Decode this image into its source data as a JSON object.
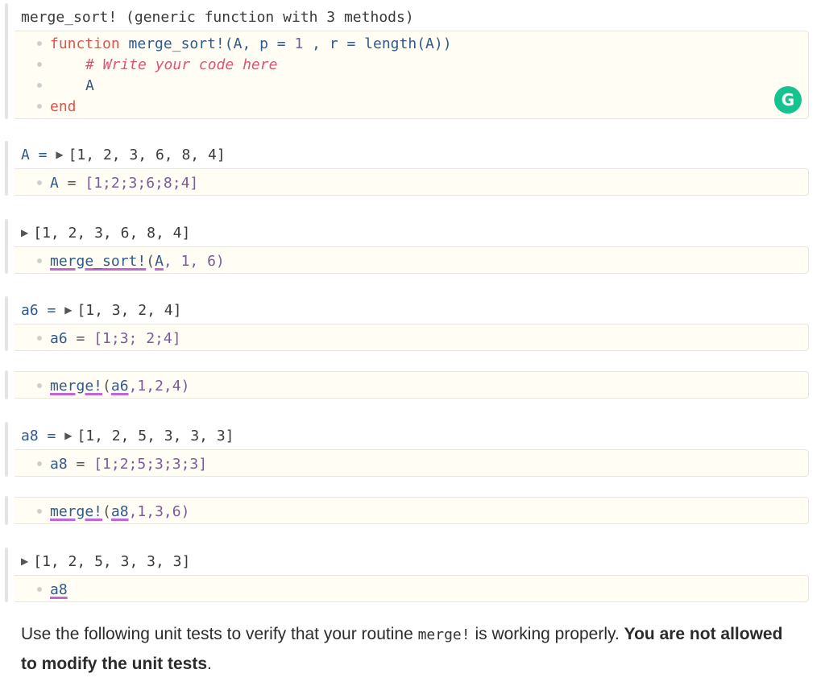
{
  "cells": {
    "merge_sort_def": {
      "output": "merge_sort! (generic function with 3 methods)",
      "code": {
        "kw_function": "function",
        "name": "merge_sort!",
        "args": "(A, p = ",
        "one": "1",
        "mid": " , r = ",
        "len": "length(A))",
        "comment": "# Write your code here",
        "ret": "A",
        "kw_end": "end"
      }
    },
    "A_cell": {
      "output_label": "A =",
      "output_value": "[1, 2, 3, 6, 8, 4]",
      "code_var": "A",
      "code_eq": " = ",
      "code_val": "[1;2;3;6;8;4]"
    },
    "merge_sort_call": {
      "output_value": "[1, 2, 3, 6, 8, 4]",
      "fn": "merge_sort!",
      "open": "(",
      "arg": "A",
      "rest": ", 1, 6)"
    },
    "a6_cell": {
      "output_label": "a6 =",
      "output_value": "[1, 3, 2, 4]",
      "code_var": "a6",
      "code_eq": " = ",
      "code_val": "[1;3; 2;4]"
    },
    "merge_a6": {
      "fn": "merge!",
      "open": "(",
      "arg": "a6",
      "rest": ",1,2,4)"
    },
    "a8_cell": {
      "output_label": "a8 =",
      "output_value": "[1, 2, 5, 3, 3, 3]",
      "code_var": "a8",
      "code_eq": " = ",
      "code_val": "[1;2;5;3;3;3]"
    },
    "merge_a8": {
      "fn": "merge!",
      "open": "(",
      "arg": "a8",
      "rest": ",1,3,6)"
    },
    "a8_show": {
      "output_value": "[1, 2, 5, 3, 3, 3]",
      "var": "a8"
    }
  },
  "prose": {
    "part1": "Use the following unit tests to verify that your routine ",
    "code": "merge!",
    "part2": " is working properly. ",
    "bold": "You are not allowed to modify the unit tests",
    "end": "."
  },
  "grammarly_icon": "grammarly-icon",
  "colors": {
    "keyword": "#e0524a",
    "identifier": "#2f5a8c",
    "number": "#7c5a9e",
    "comment": "#e0527a",
    "input_bg": "#fffdf4",
    "grammarly": "#14c38e"
  }
}
